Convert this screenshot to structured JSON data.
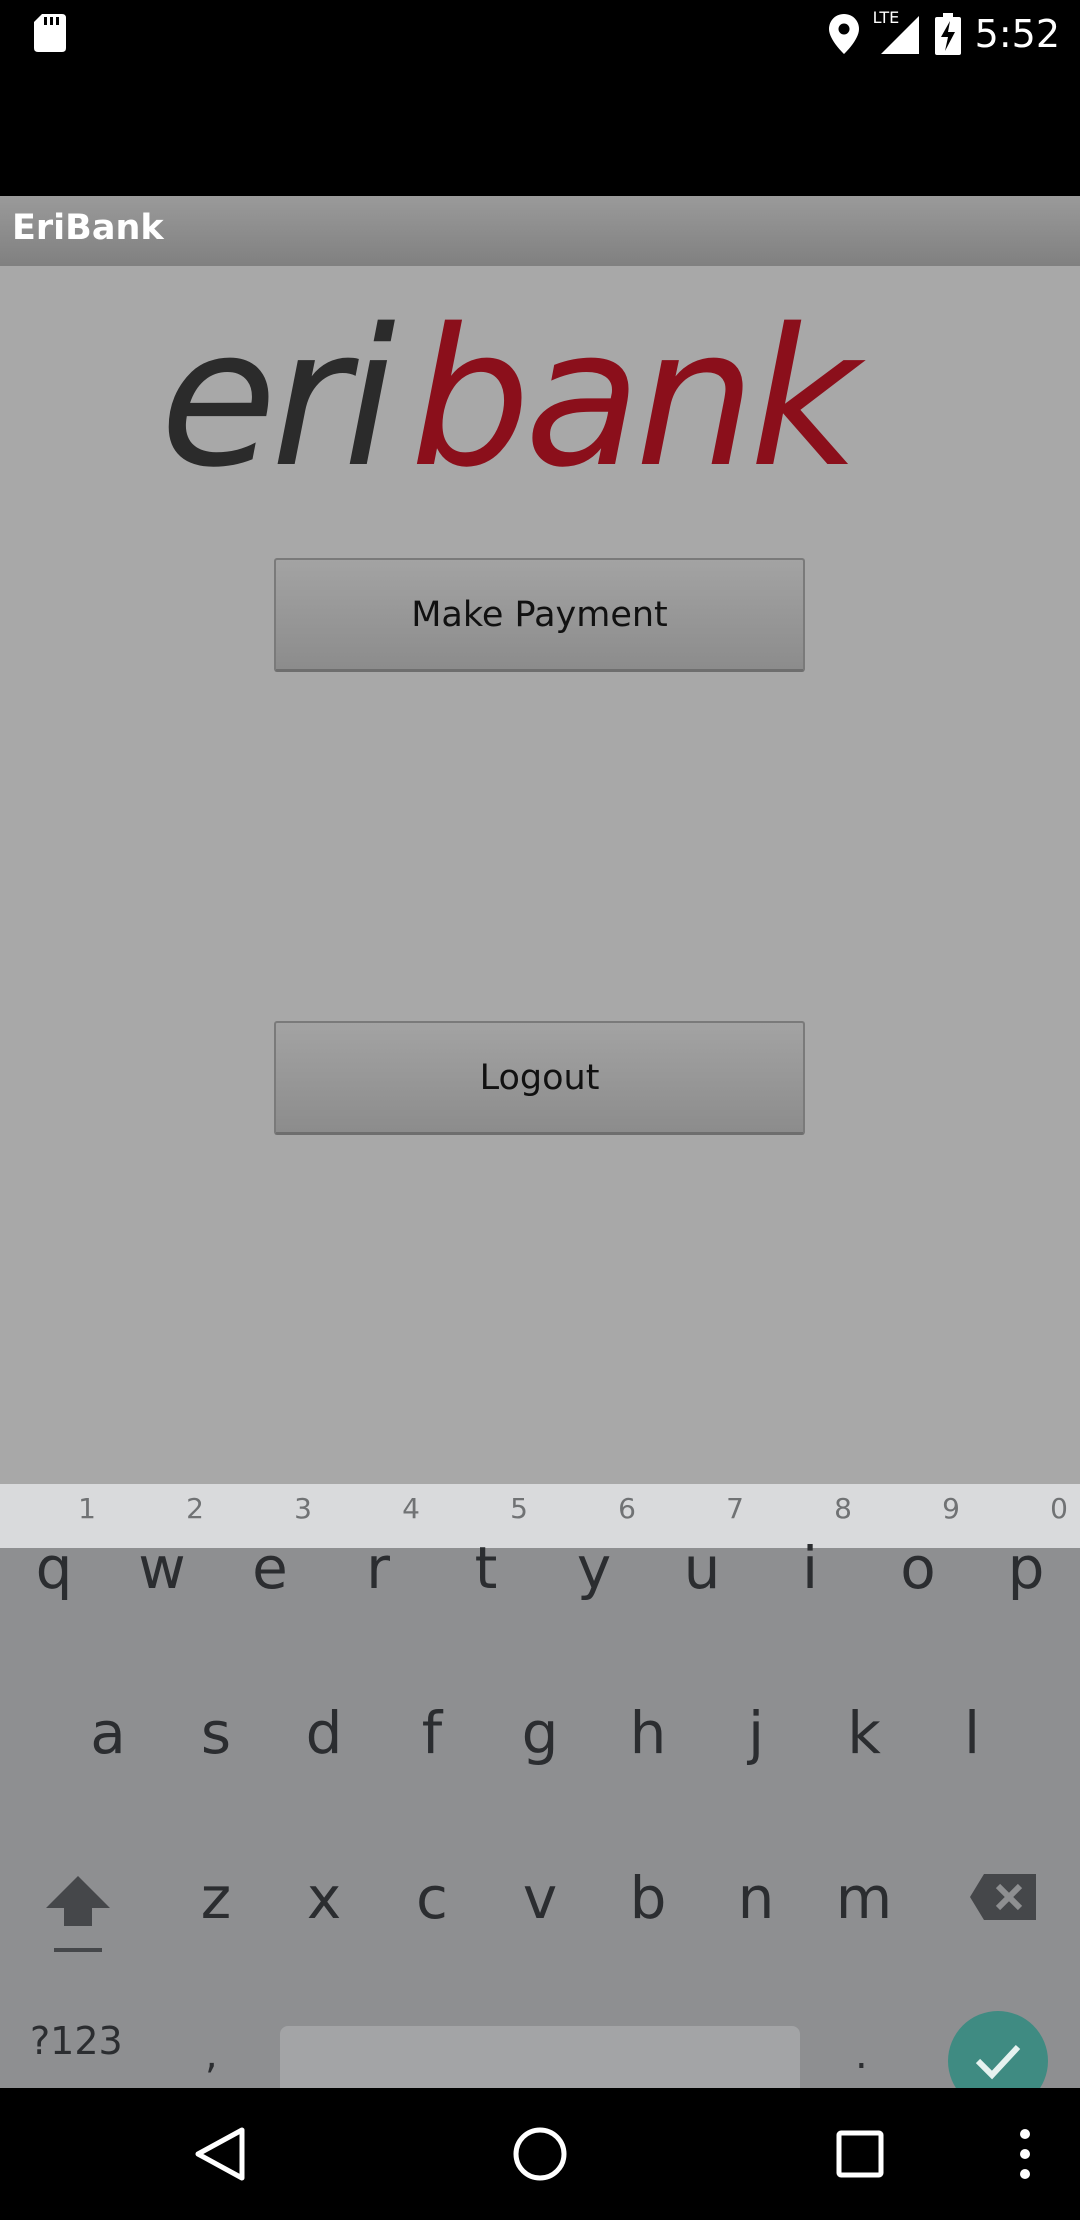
{
  "status_bar": {
    "time": "5:52",
    "network_label": "LTE",
    "icons": [
      "sd-card-icon",
      "location-icon",
      "signal-icon",
      "battery-charging-icon"
    ]
  },
  "app": {
    "title": "EriBank",
    "logo_part1": "eri",
    "logo_part2": "bank",
    "logo_colors": {
      "eri": "#2b2b2b",
      "bank": "#8b0f1b"
    }
  },
  "buttons": {
    "make_payment": "Make Payment",
    "logout": "Logout"
  },
  "keyboard": {
    "numbers": [
      "1",
      "2",
      "3",
      "4",
      "5",
      "6",
      "7",
      "8",
      "9",
      "0"
    ],
    "row1": [
      "q",
      "w",
      "e",
      "r",
      "t",
      "y",
      "u",
      "i",
      "o",
      "p"
    ],
    "row2": [
      "a",
      "s",
      "d",
      "f",
      "g",
      "h",
      "j",
      "k",
      "l"
    ],
    "row3": [
      "z",
      "x",
      "c",
      "v",
      "b",
      "n",
      "m"
    ],
    "symbols_label": "?123",
    "comma": ",",
    "period": "."
  },
  "colors": {
    "content_bg": "#a8a8a8",
    "action_bar": "#8c8c8c",
    "keyboard_bg": "#8e8f91",
    "enter_key": "#3f8b82"
  }
}
